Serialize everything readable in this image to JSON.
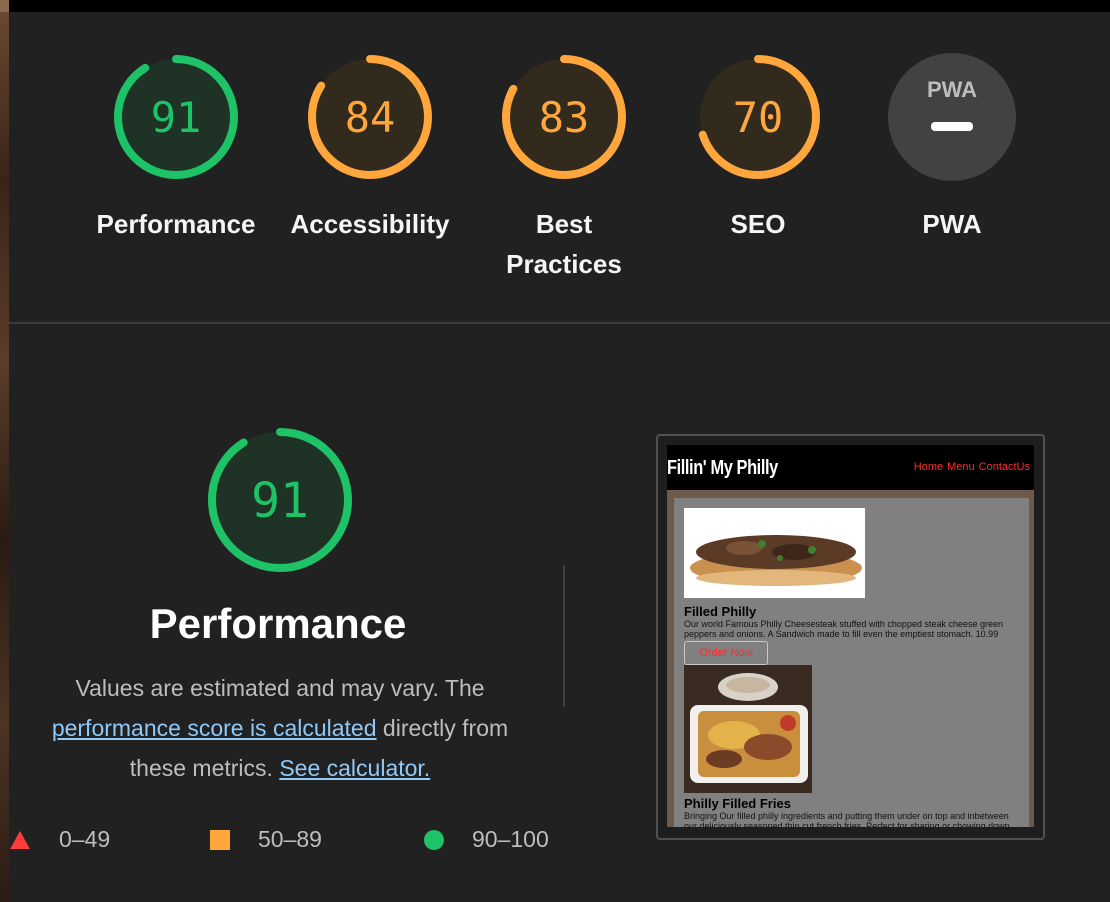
{
  "categories": [
    {
      "label": "Performance",
      "score": "91",
      "value": 91,
      "color": "#1ec267",
      "track": "#1d3b2a"
    },
    {
      "label": "Accessibility",
      "score": "84",
      "value": 84,
      "color": "#ffa63d",
      "track": "#3d2f1c"
    },
    {
      "label": "Best Practices",
      "score": "83",
      "value": 83,
      "color": "#ffa63d",
      "track": "#3d2f1c"
    },
    {
      "label": "SEO",
      "score": "70",
      "value": 70,
      "color": "#ffa63d",
      "track": "#3d2f1c"
    },
    {
      "label": "PWA",
      "badge": "PWA",
      "icon": "pwa-badge-icon"
    }
  ],
  "performance": {
    "score": "91",
    "value": 91,
    "title": "Performance",
    "desc_before": "Values are estimated and may vary. The ",
    "link1": "performance score is calculated",
    "desc_middle": " directly from these metrics. ",
    "link2": "See calculator."
  },
  "legend": [
    {
      "range": "0–49",
      "shape": "triangle",
      "color": "#ff3b3b"
    },
    {
      "range": "50–89",
      "shape": "square",
      "color": "#ffa63d"
    },
    {
      "range": "90–100",
      "shape": "circle",
      "color": "#1ec267"
    }
  ],
  "preview": {
    "site_title": "Fillin' My Philly",
    "nav": [
      "Home",
      "Menu",
      "ContactUs"
    ],
    "items": [
      {
        "name": "Filled Philly",
        "desc": "Our world Famous Philly Cheesesteak stuffed with chopped steak cheese green peppers and onions. A Sandwich made to fill even the emptiest stomach. 10.99",
        "button": "Order Now"
      },
      {
        "name": "Philly Filled Fries",
        "desc": "Bringing Our filled philly ingredients and putting them under on top and inbetween our deliciously seasoned thin cut french fries. Perfect for sharing or chowing down"
      }
    ]
  }
}
